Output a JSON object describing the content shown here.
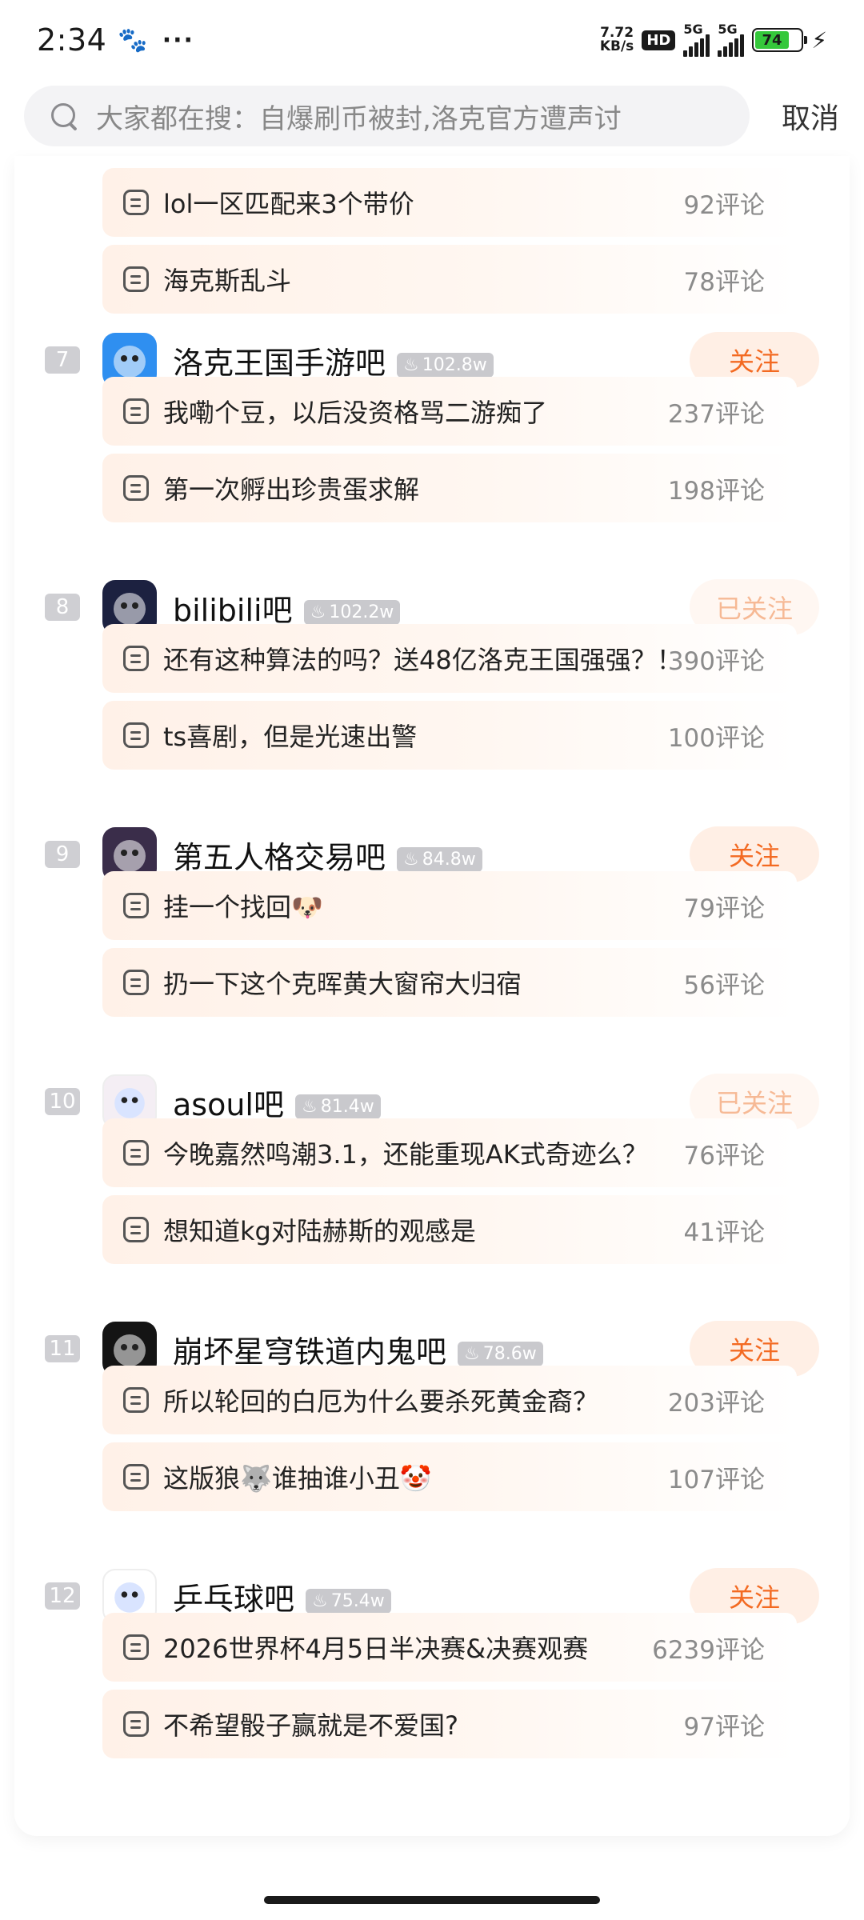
{
  "status_bar": {
    "time": "2:34",
    "dots": "···",
    "net_speed_value": "7.72",
    "net_speed_unit": "KB/s",
    "hd": "HD",
    "signal1": "5G",
    "signal2": "5G",
    "battery": "74",
    "battery_level": 0.74
  },
  "search": {
    "placeholder": "大家都在搜：自爆刷币被封,洛克官方遭声讨",
    "cancel": "取消"
  },
  "top_posts": [
    {
      "title": "lol一区匹配来3个带价",
      "comments": "92评论"
    },
    {
      "title": "海克斯乱斗",
      "comments": "78评论"
    }
  ],
  "forums": [
    {
      "rank": "7",
      "name": "洛克王国手游吧",
      "heat": "102.8w",
      "follow": "关注",
      "followed": false,
      "avatar_color": "#2f8ff0",
      "posts": [
        {
          "title": "我嘞个豆，以后没资格骂二游痴了",
          "comments": "237评论"
        },
        {
          "title": "第一次孵出珍贵蛋求解",
          "comments": "198评论"
        }
      ]
    },
    {
      "rank": "8",
      "name": "bilibili吧",
      "heat": "102.2w",
      "follow": "已关注",
      "followed": true,
      "avatar_color": "#1c2140",
      "posts": [
        {
          "title": "还有这种算法的吗？送48亿洛克王国强强？！",
          "comments": "390评论"
        },
        {
          "title": "ts喜剧，但是光速出警",
          "comments": "100评论"
        }
      ]
    },
    {
      "rank": "9",
      "name": "第五人格交易吧",
      "heat": "84.8w",
      "follow": "关注",
      "followed": false,
      "avatar_color": "#3a2d4a",
      "posts": [
        {
          "title": "挂一个找回🐶",
          "comments": "79评论"
        },
        {
          "title": "扔一下这个克晖黄大窗帘大归宿",
          "comments": "56评论"
        }
      ]
    },
    {
      "rank": "10",
      "name": "asoul吧",
      "heat": "81.4w",
      "follow": "已关注",
      "followed": true,
      "avatar_color": "#f4eef4",
      "posts": [
        {
          "title": "今晚嘉然鸣潮3.1，还能重现AK式奇迹么？",
          "comments": "76评论"
        },
        {
          "title": "想知道kg对陆赫斯的观感是",
          "comments": "41评论"
        }
      ]
    },
    {
      "rank": "11",
      "name": "崩坏星穹铁道内鬼吧",
      "heat": "78.6w",
      "follow": "关注",
      "followed": false,
      "avatar_color": "#141414",
      "posts": [
        {
          "title": "所以轮回的白厄为什么要杀死黄金裔？",
          "comments": "203评论"
        },
        {
          "title": "这版狼🐺谁抽谁小丑🤡",
          "comments": "107评论"
        }
      ]
    },
    {
      "rank": "12",
      "name": "乒乓球吧",
      "heat": "75.4w",
      "follow": "关注",
      "followed": false,
      "avatar_color": "#ffffff",
      "posts": [
        {
          "title": "2026世界杯4月5日半决赛&决赛观赛",
          "comments": "6239评论"
        },
        {
          "title": "不希望骰子赢就是不爱国?",
          "comments": "97评论"
        }
      ]
    }
  ]
}
